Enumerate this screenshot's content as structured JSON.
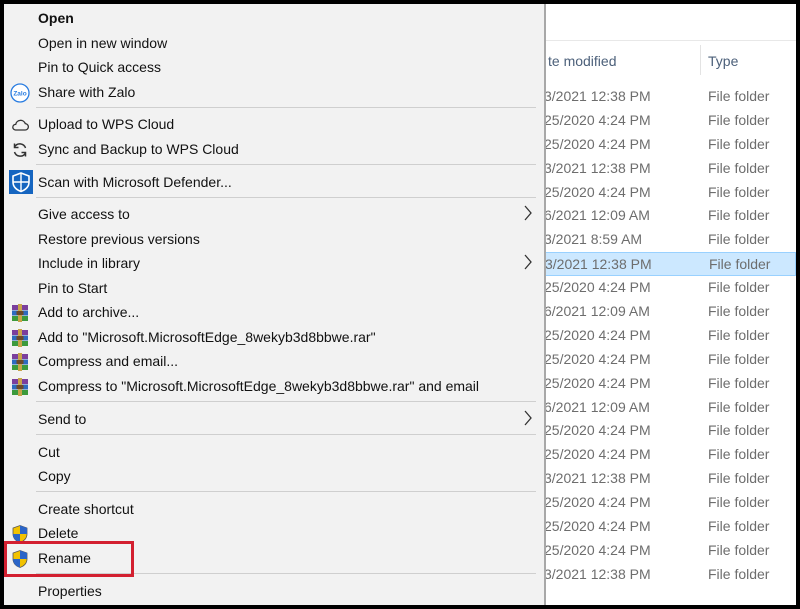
{
  "explorer": {
    "columns": {
      "date_modified": "te modified",
      "type": "Type"
    },
    "rows": [
      {
        "date": "3/2021 12:38 PM",
        "type": "File folder"
      },
      {
        "date": "25/2020 4:24 PM",
        "type": "File folder"
      },
      {
        "date": "25/2020 4:24 PM",
        "type": "File folder"
      },
      {
        "date": "3/2021 12:38 PM",
        "type": "File folder"
      },
      {
        "date": "25/2020 4:24 PM",
        "type": "File folder"
      },
      {
        "date": "6/2021 12:09 AM",
        "type": "File folder"
      },
      {
        "date": "3/2021 8:59 AM",
        "type": "File folder"
      },
      {
        "date": "3/2021 12:38 PM",
        "type": "File folder",
        "selected": true
      },
      {
        "date": "25/2020 4:24 PM",
        "type": "File folder"
      },
      {
        "date": "6/2021 12:09 AM",
        "type": "File folder"
      },
      {
        "date": "25/2020 4:24 PM",
        "type": "File folder"
      },
      {
        "date": "25/2020 4:24 PM",
        "type": "File folder"
      },
      {
        "date": "25/2020 4:24 PM",
        "type": "File folder"
      },
      {
        "date": "6/2021 12:09 AM",
        "type": "File folder"
      },
      {
        "date": "25/2020 4:24 PM",
        "type": "File folder"
      },
      {
        "date": "25/2020 4:24 PM",
        "type": "File folder"
      },
      {
        "date": "3/2021 12:38 PM",
        "type": "File folder"
      },
      {
        "date": "25/2020 4:24 PM",
        "type": "File folder"
      },
      {
        "date": "25/2020 4:24 PM",
        "type": "File folder"
      },
      {
        "date": "25/2020 4:24 PM",
        "type": "File folder"
      },
      {
        "date": "3/2021 12:38 PM",
        "type": "File folder"
      }
    ]
  },
  "menu": {
    "open": "Open",
    "open_new_window": "Open in new window",
    "pin_quick_access": "Pin to Quick access",
    "share_zalo": "Share with Zalo",
    "upload_wps": "Upload to WPS Cloud",
    "sync_wps": "Sync and Backup to WPS Cloud",
    "scan_defender": "Scan with Microsoft Defender...",
    "give_access": "Give access to",
    "restore_versions": "Restore previous versions",
    "include_library": "Include in library",
    "pin_start": "Pin to Start",
    "add_archive": "Add to archive...",
    "add_rar": "Add to \"Microsoft.MicrosoftEdge_8wekyb3d8bbwe.rar\"",
    "compress_email": "Compress and email...",
    "compress_rar_email": "Compress to \"Microsoft.MicrosoftEdge_8wekyb3d8bbwe.rar\" and email",
    "send_to": "Send to",
    "cut": "Cut",
    "copy": "Copy",
    "create_shortcut": "Create shortcut",
    "delete": "Delete",
    "rename": "Rename",
    "properties": "Properties",
    "zalo_icon_text": "Zalo"
  },
  "colors": {
    "highlight": "#d32030",
    "selection": "#cce8ff",
    "defender_blue": "#1565c0"
  }
}
